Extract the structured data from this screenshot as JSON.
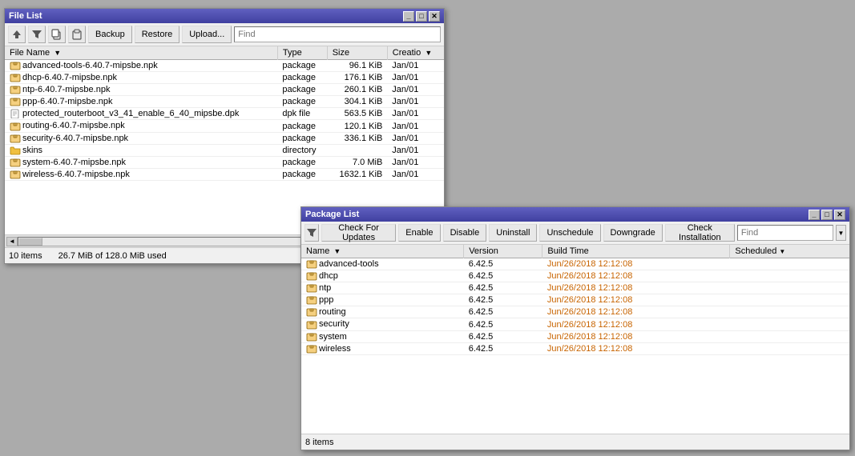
{
  "fileListWindow": {
    "title": "File List",
    "toolbar": {
      "backupLabel": "Backup",
      "restoreLabel": "Restore",
      "uploadLabel": "Upload...",
      "searchPlaceholder": "Find"
    },
    "table": {
      "columns": [
        "File Name",
        "Type",
        "Size",
        "Creatio"
      ],
      "rows": [
        {
          "name": "advanced-tools-6.40.7-mipsbe.npk",
          "type": "package",
          "size": "96.1 KiB",
          "date": "Jan/01"
        },
        {
          "name": "dhcp-6.40.7-mipsbe.npk",
          "type": "package",
          "size": "176.1 KiB",
          "date": "Jan/01"
        },
        {
          "name": "ntp-6.40.7-mipsbe.npk",
          "type": "package",
          "size": "260.1 KiB",
          "date": "Jan/01"
        },
        {
          "name": "ppp-6.40.7-mipsbe.npk",
          "type": "package",
          "size": "304.1 KiB",
          "date": "Jan/01"
        },
        {
          "name": "protected_routerboot_v3_41_enable_6_40_mipsbe.dpk",
          "type": "dpk file",
          "size": "563.5 KiB",
          "date": "Jan/01"
        },
        {
          "name": "routing-6.40.7-mipsbe.npk",
          "type": "package",
          "size": "120.1 KiB",
          "date": "Jan/01"
        },
        {
          "name": "security-6.40.7-mipsbe.npk",
          "type": "package",
          "size": "336.1 KiB",
          "date": "Jan/01"
        },
        {
          "name": "skins",
          "type": "directory",
          "size": "",
          "date": "Jan/01"
        },
        {
          "name": "system-6.40.7-mipsbe.npk",
          "type": "package",
          "size": "7.0 MiB",
          "date": "Jan/01"
        },
        {
          "name": "wireless-6.40.7-mipsbe.npk",
          "type": "package",
          "size": "1632.1 KiB",
          "date": "Jan/01"
        }
      ]
    },
    "statusBar": {
      "itemCount": "10 items",
      "usage": "26.7 MiB of 128.0 MiB used"
    }
  },
  "packageListWindow": {
    "title": "Package List",
    "toolbar": {
      "checkForUpdatesLabel": "Check For Updates",
      "enableLabel": "Enable",
      "disableLabel": "Disable",
      "uninstallLabel": "Uninstall",
      "unscheduleLabel": "Unschedule",
      "downgradeLabel": "Downgrade",
      "checkInstallationLabel": "Check Installation",
      "searchPlaceholder": "Find"
    },
    "table": {
      "columns": [
        "Name",
        "Version",
        "Build Time",
        "Scheduled"
      ],
      "rows": [
        {
          "name": "advanced-tools",
          "version": "6.42.5",
          "buildTime": "Jun/26/2018 12:12:08",
          "scheduled": ""
        },
        {
          "name": "dhcp",
          "version": "6.42.5",
          "buildTime": "Jun/26/2018 12:12:08",
          "scheduled": ""
        },
        {
          "name": "ntp",
          "version": "6.42.5",
          "buildTime": "Jun/26/2018 12:12:08",
          "scheduled": ""
        },
        {
          "name": "ppp",
          "version": "6.42.5",
          "buildTime": "Jun/26/2018 12:12:08",
          "scheduled": ""
        },
        {
          "name": "routing",
          "version": "6.42.5",
          "buildTime": "Jun/26/2018 12:12:08",
          "scheduled": ""
        },
        {
          "name": "security",
          "version": "6.42.5",
          "buildTime": "Jun/26/2018 12:12:08",
          "scheduled": ""
        },
        {
          "name": "system",
          "version": "6.42.5",
          "buildTime": "Jun/26/2018 12:12:08",
          "scheduled": ""
        },
        {
          "name": "wireless",
          "version": "6.42.5",
          "buildTime": "Jun/26/2018 12:12:08",
          "scheduled": ""
        }
      ]
    },
    "statusBar": {
      "itemCount": "8 items"
    }
  },
  "icons": {
    "filter": "▼",
    "copy": "⊞",
    "paste": "⊟",
    "sortAsc": "▼",
    "chevronDown": "▼",
    "chevronRight": "▶",
    "left": "◄",
    "right": "►"
  }
}
